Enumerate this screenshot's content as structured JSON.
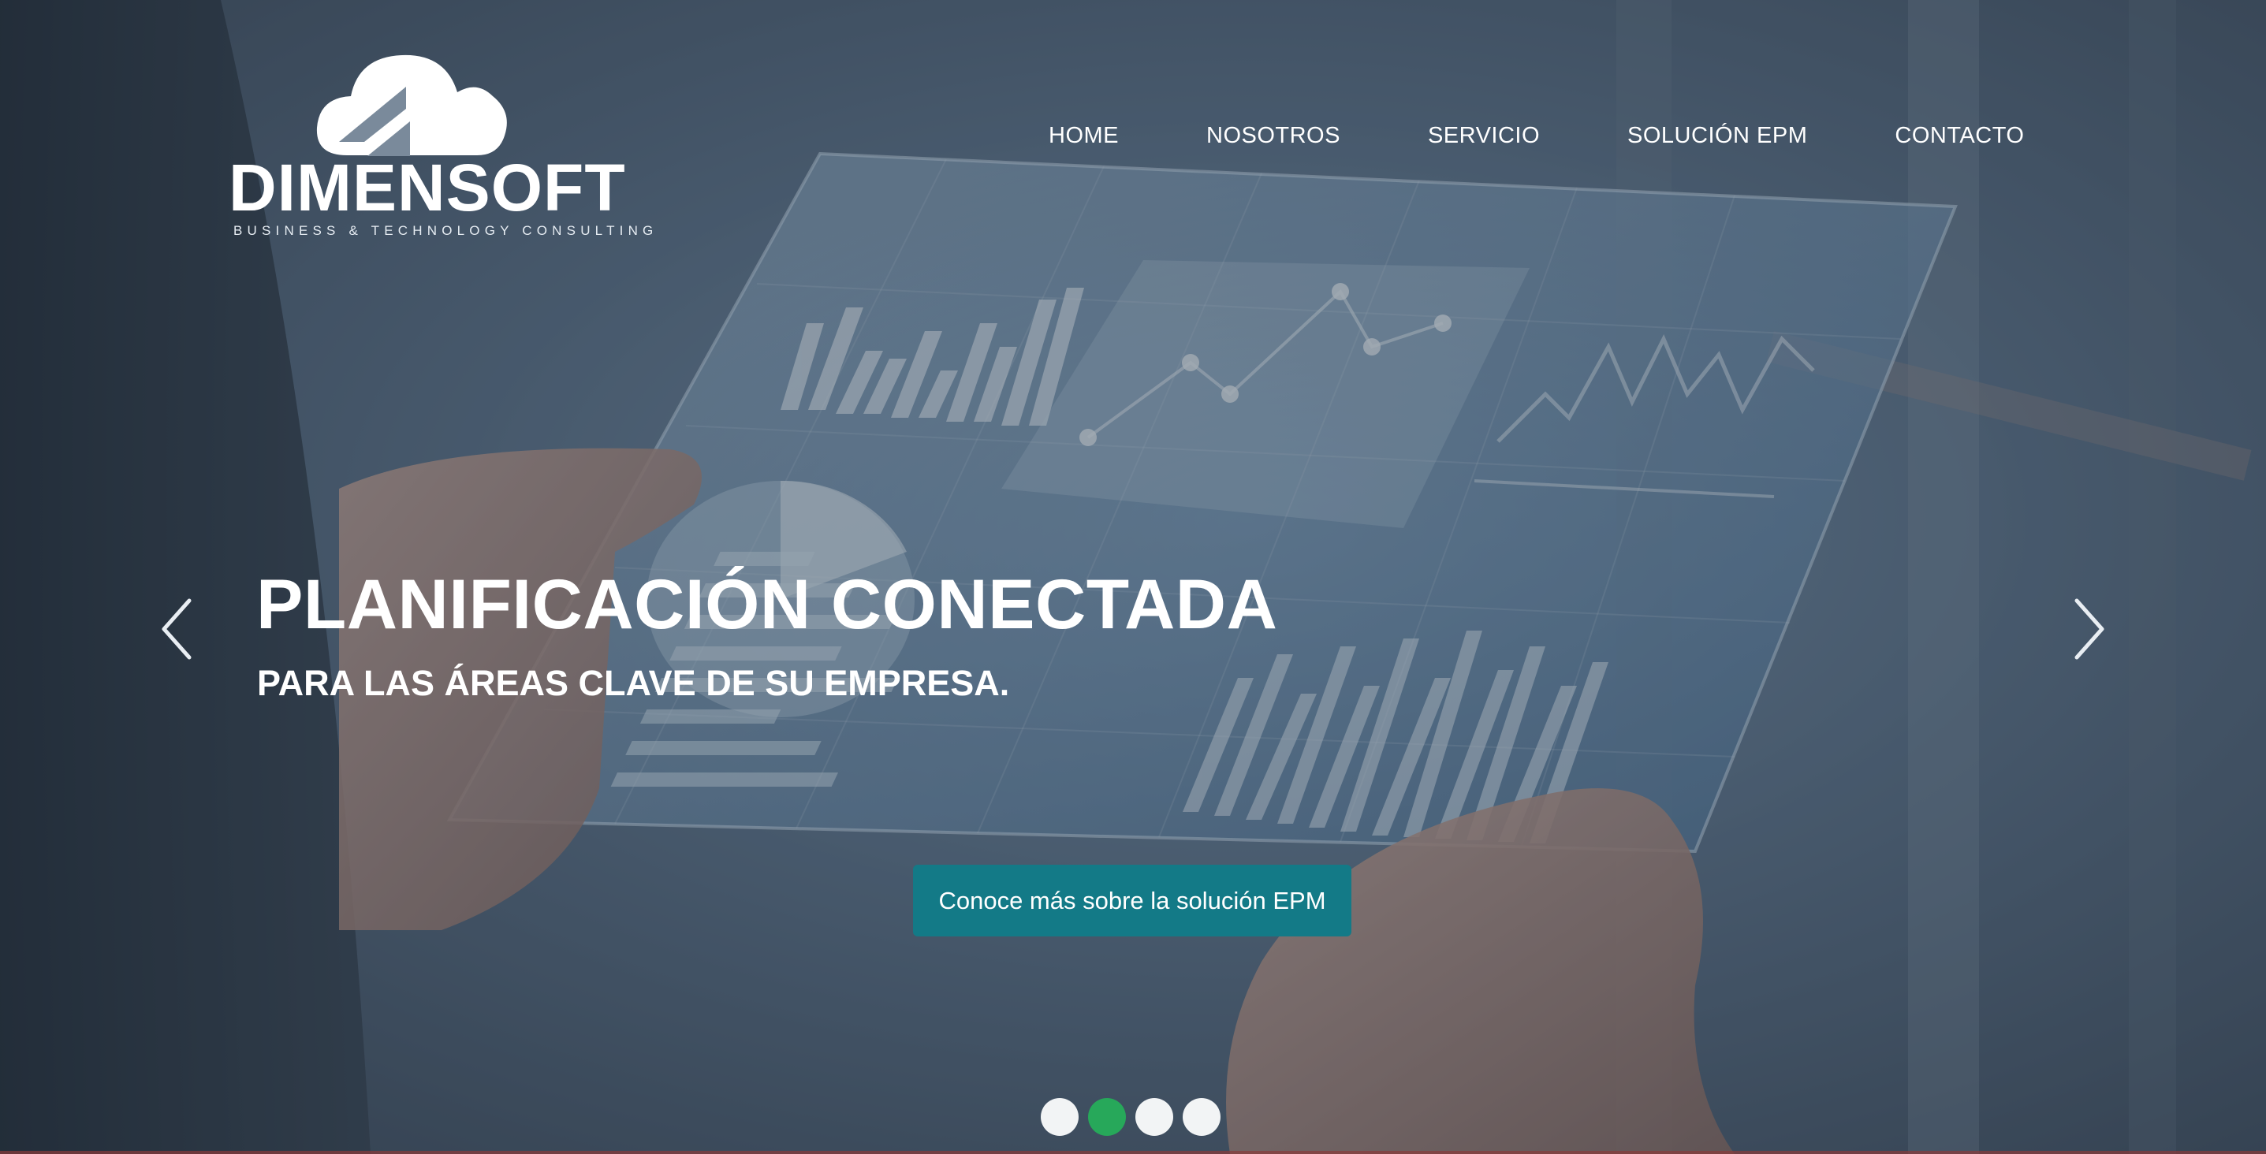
{
  "brand": {
    "name": "DIMENSOFT",
    "tagline": "BUSINESS & TECHNOLOGY CONSULTING"
  },
  "nav": {
    "items": [
      {
        "label": "HOME"
      },
      {
        "label": "NOSOTROS"
      },
      {
        "label": "SERVICIO"
      },
      {
        "label": "SOLUCIÓN EPM"
      },
      {
        "label": "CONTACTO"
      }
    ]
  },
  "hero": {
    "headline": "PLANIFICACIÓN CONECTADA",
    "subheadline": "PARA LAS ÁREAS CLAVE DE SU EMPRESA.",
    "cta_label": "Conoce más sobre la solución EPM"
  },
  "carousel": {
    "prev_icon": "chevron-left-icon",
    "next_icon": "chevron-right-icon",
    "slide_count": 4,
    "active_slide": 2
  },
  "colors": {
    "cta_background": "#137a87",
    "active_dot": "#27a85a",
    "inactive_dot": "#f2f4f5",
    "text": "#ffffff"
  }
}
